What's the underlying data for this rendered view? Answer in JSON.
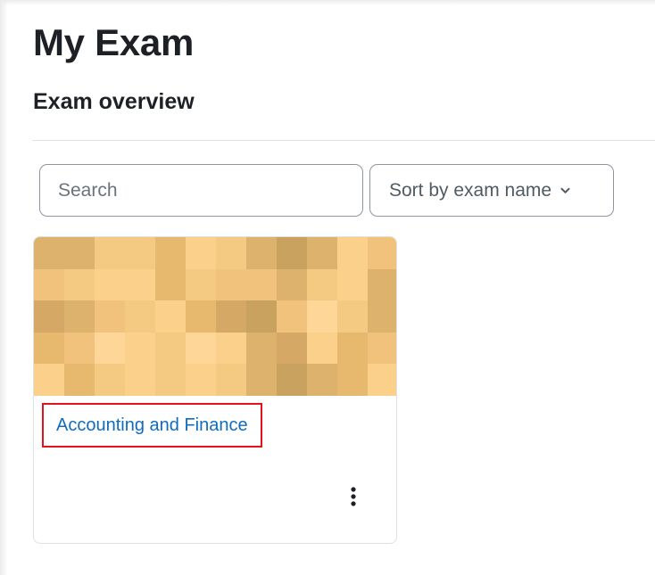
{
  "header": {
    "title": "My Exam",
    "section": "Exam overview"
  },
  "filters": {
    "search_placeholder": "Search",
    "sort_label": "Sort by exam name",
    "sort_icon": "chevron-down-icon"
  },
  "courses": [
    {
      "name": "Accounting and Finance",
      "menu_icon": "kebab-menu-icon",
      "image_palette": [
        "#c9a25f",
        "#dcb26d",
        "#f0c27b",
        "#f4c982",
        "#fbd08a",
        "#e7b96f",
        "#d6a866",
        "#fdd698"
      ]
    }
  ]
}
